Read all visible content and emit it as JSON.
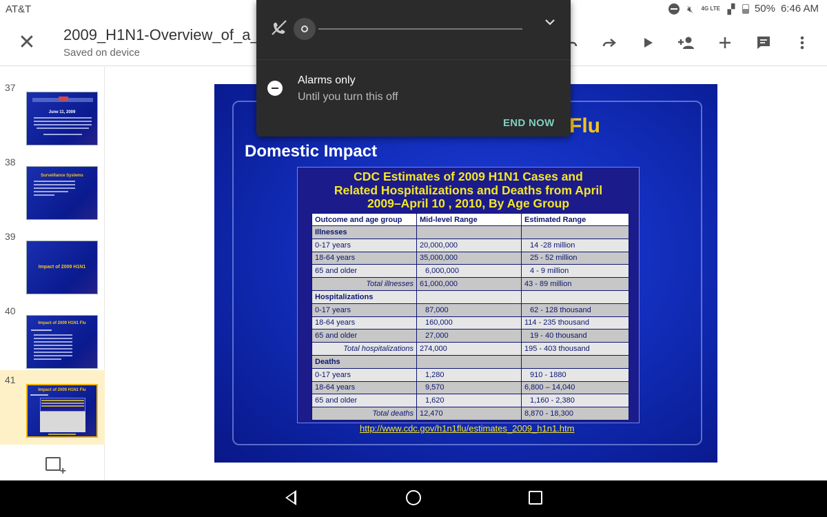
{
  "status_bar": {
    "carrier": "AT&T",
    "battery": "50%",
    "time": "6:46 AM",
    "network": "4G LTE"
  },
  "toolbar": {
    "title": "2009_H1N1-Overview_of_a_",
    "subtitle": "Saved on device",
    "icons": [
      "close-icon",
      "undo-icon",
      "redo-icon",
      "play-icon",
      "add-person-icon",
      "add-icon",
      "comment-icon",
      "more-icon"
    ]
  },
  "thumbnails": [
    {
      "number": "37",
      "caption": "June 11, 2009"
    },
    {
      "number": "38",
      "caption": "Surveillance Systems"
    },
    {
      "number": "39",
      "caption": "Impact of 2009 H1N1"
    },
    {
      "number": "40",
      "caption": "Impact of 2009 H1N1 Flu"
    },
    {
      "number": "41",
      "caption": "Impact of 2009 H1N1 Flu"
    }
  ],
  "slide": {
    "heading": "Flu",
    "subheading": "Domestic Impact",
    "table_title": [
      "CDC Estimates of 2009 H1N1 Cases and",
      "Related Hospitalizations and Deaths from April",
      "2009–April 10 , 2010, By Age Group"
    ],
    "columns": [
      "Outcome and age group",
      "Mid-level Range",
      "Estimated Range"
    ],
    "sections": [
      {
        "name": "Illnesses",
        "rows": [
          [
            "0-17 years",
            "20,000,000",
            "14  -28 million"
          ],
          [
            "18-64 years",
            "35,000,000",
            "25 - 52 million"
          ],
          [
            "65 and older",
            "  6,000,000",
            "  4 - 9 million"
          ]
        ],
        "total": [
          "Total illnesses",
          "61,000,000",
          "43 - 89 million"
        ]
      },
      {
        "name": "Hospitalizations",
        "rows": [
          [
            "0-17 years",
            "  87,000",
            "  62 - 128 thousand"
          ],
          [
            "18-64 years",
            "160,000",
            "114 - 235 thousand"
          ],
          [
            "65 and older",
            "  27,000",
            "  19 - 40 thousand"
          ]
        ],
        "total": [
          "Total hospitalizations",
          "274,000",
          "195 - 403 thousand"
        ]
      },
      {
        "name": "Deaths",
        "rows": [
          [
            "0-17 years",
            "  1,280",
            "  910 - 1880"
          ],
          [
            "18-64 years",
            "  9,570",
            "6,800 – 14,040"
          ],
          [
            "65 and older",
            "  1,620",
            "  1,160 - 2,380"
          ]
        ],
        "total": [
          "Total deaths",
          "12,470",
          "8,870  - 18,300"
        ]
      }
    ],
    "link": "http://www.cdc.gov/h1n1flu/estimates_2009_h1n1.htm"
  },
  "notification_shade": {
    "mode_title": "Alarms only",
    "mode_subtitle": "Until you turn this off",
    "end_button": "END NOW",
    "volume_level": 0
  },
  "colors": {
    "slide_blue": "#1330c0",
    "title_yellow": "#f5c518",
    "shade_bg": "#2b2b2b",
    "accent_teal": "#7fcfc2",
    "selected_thumb": "#fef1c7"
  }
}
